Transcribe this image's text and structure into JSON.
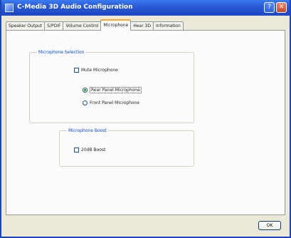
{
  "window": {
    "title": "C-Media 3D Audio Configuration"
  },
  "tabs": [
    {
      "label": "Speaker Output"
    },
    {
      "label": "S/PDIF"
    },
    {
      "label": "Volume Control"
    },
    {
      "label": "Microphone",
      "active": true
    },
    {
      "label": "Hear 3D"
    },
    {
      "label": "Information"
    }
  ],
  "mic_selection": {
    "title": "Microphone Selection",
    "mute": {
      "label": "Mute Microphone",
      "checked": false
    },
    "rear": {
      "label": "Rear Panel Microphone",
      "selected": true
    },
    "front": {
      "label": "Front Panel Microphone",
      "selected": false
    }
  },
  "mic_boost": {
    "title": "Microphone Boost",
    "boost": {
      "label": "20dB Boost",
      "checked": false
    }
  },
  "ok_label": "OK",
  "colors": {
    "title_bar": "#2a5bd7",
    "group_title": "#0046d5",
    "active_tab_accent": "#f6a929"
  }
}
